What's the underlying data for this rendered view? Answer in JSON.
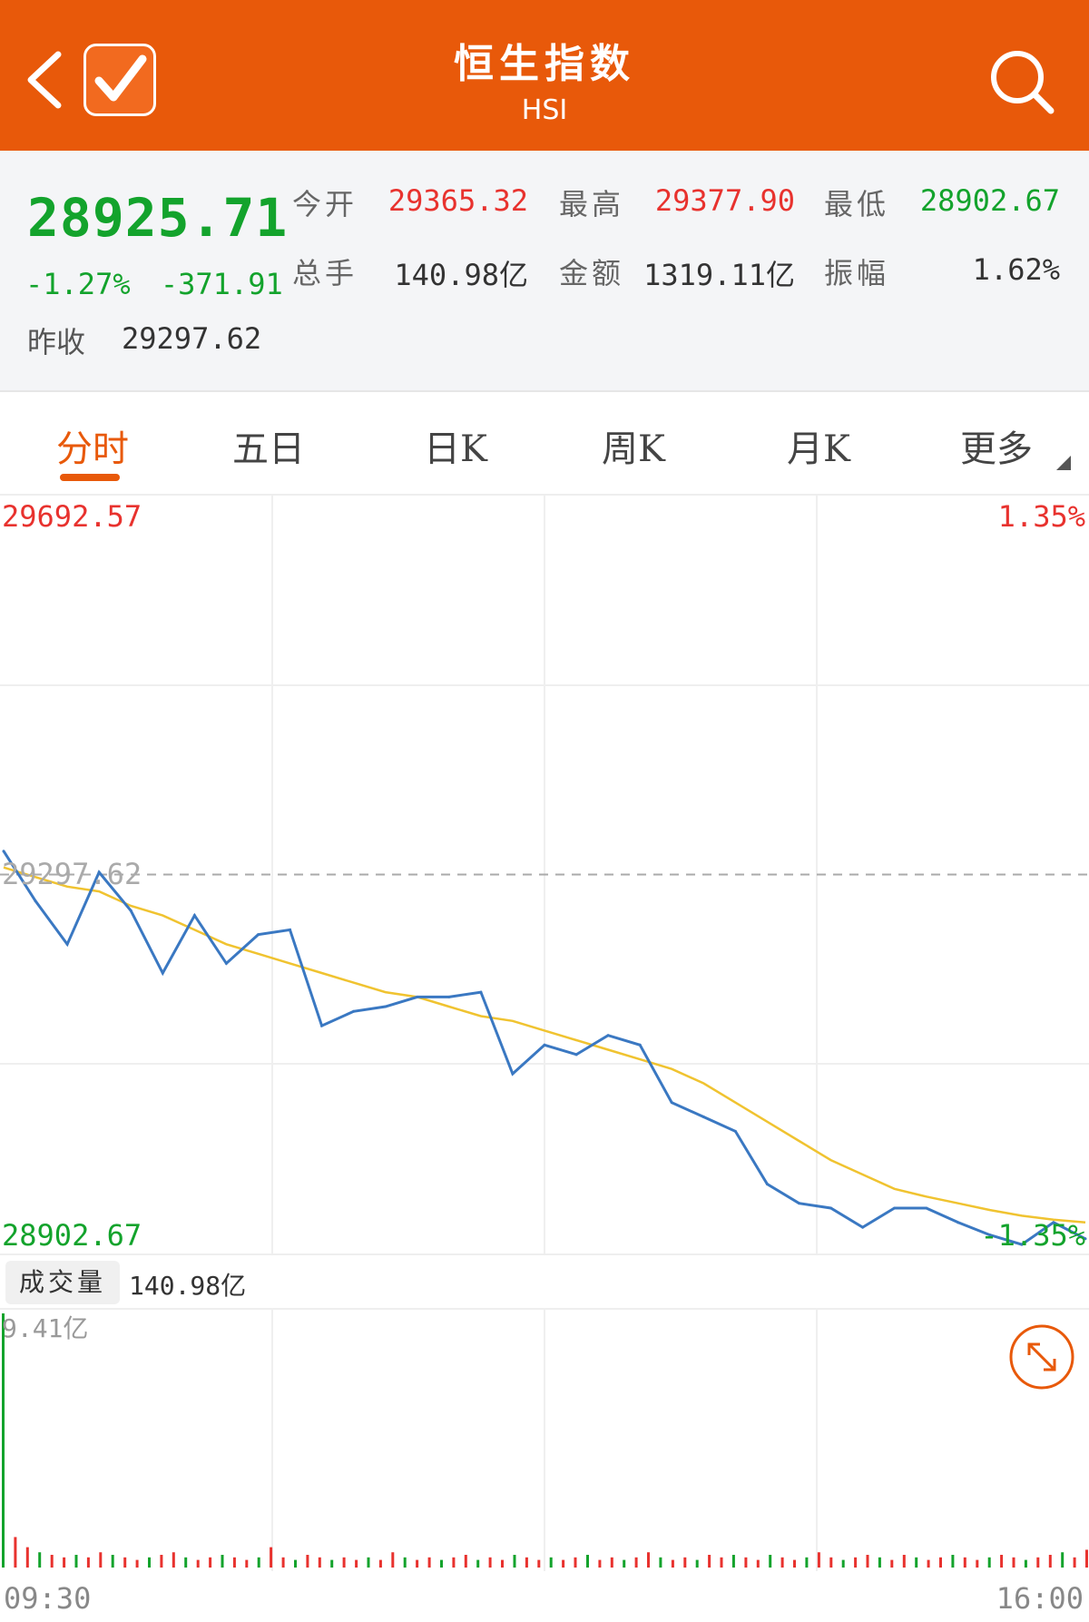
{
  "header": {
    "title": "恒生指数",
    "subtitle": "HSI",
    "back_icon": "chevron-left-icon",
    "watch_icon": "checkbox-checked-icon",
    "search_icon": "search-icon"
  },
  "quote": {
    "price": "28925.71",
    "change_pct": "-1.27%",
    "change_abs": "-371.91",
    "prev_close_label": "昨收",
    "prev_close": "29297.62",
    "stats": [
      {
        "label": "今开",
        "value": "29365.32",
        "color": "#e8322e"
      },
      {
        "label": "最高",
        "value": "29377.90",
        "color": "#e8322e"
      },
      {
        "label": "最低",
        "value": "28902.67",
        "color": "#13a32c"
      },
      {
        "label": "总手",
        "value": "140.98亿",
        "color": "#333333"
      },
      {
        "label": "金额",
        "value": "1319.11亿",
        "color": "#333333"
      },
      {
        "label": "振幅",
        "value": "1.62%",
        "color": "#333333"
      }
    ]
  },
  "tabs": [
    {
      "label": "分时",
      "active": true
    },
    {
      "label": "五日",
      "active": false
    },
    {
      "label": "日K",
      "active": false
    },
    {
      "label": "周K",
      "active": false
    },
    {
      "label": "月K",
      "active": false
    },
    {
      "label": "更多",
      "active": false
    }
  ],
  "chart_labels": {
    "top_left": "29692.57",
    "top_right": "1.35%",
    "mid_left": "29297.62",
    "bottom_left": "28902.67",
    "bottom_right": "-1.35%"
  },
  "volume": {
    "label": "成交量",
    "total": "140.98亿",
    "max_label": "9.41亿",
    "expand_icon": "expand-icon"
  },
  "time_axis": {
    "start": "09:30",
    "end": "16:00"
  },
  "colors": {
    "brand": "#e8590a",
    "up": "#e8322e",
    "down": "#13a32c",
    "price_line": "#3a78c2",
    "avg_line": "#f0c330"
  },
  "chart_data": {
    "type": "line",
    "ylim": [
      28902.67,
      29692.57
    ],
    "baseline": 29297.62,
    "xlim": [
      "09:30",
      "16:00"
    ],
    "series": [
      {
        "name": "",
        "x": [
          "09:30",
          "09:40",
          "09:50",
          "10:00",
          "10:10",
          "10:20",
          "10:30",
          "10:40",
          "10:50",
          "11:00",
          "11:10",
          "11:20",
          "11:30",
          "11:40",
          "11:50",
          "12:00",
          "13:00",
          "13:10",
          "13:20",
          "13:30",
          "13:40",
          "13:50",
          "14:00",
          "14:10",
          "14:20",
          "14:30",
          "14:40",
          "14:50",
          "15:00",
          "15:10",
          "15:20",
          "15:30",
          "15:40",
          "15:50",
          "16:00"
        ],
        "values": [
          29322,
          29270,
          29225,
          29300,
          29260,
          29195,
          29255,
          29205,
          29235,
          29240,
          29140,
          29155,
          29160,
          29170,
          29170,
          29175,
          29090,
          29120,
          29110,
          29130,
          29120,
          29060,
          29045,
          29030,
          28975,
          28955,
          28950,
          28930,
          28950,
          28950,
          28935,
          28922,
          28912,
          28935,
          28918
        ]
      },
      {
        "name": "",
        "values": [
          29305,
          29295,
          29285,
          29280,
          29265,
          29255,
          29240,
          29225,
          29215,
          29205,
          29195,
          29185,
          29175,
          29170,
          29160,
          29150,
          29145,
          29135,
          29125,
          29115,
          29105,
          29095,
          29080,
          29060,
          29040,
          29020,
          29000,
          28985,
          28970,
          28962,
          28955,
          28948,
          28942,
          28938,
          28935
        ]
      }
    ]
  },
  "volume_data": {
    "type": "bar",
    "max_value_label": "9.41亿",
    "values": [
      1.0,
      0.12,
      0.08,
      0.06,
      0.05,
      0.04,
      0.05,
      0.04,
      0.06,
      0.05,
      0.04,
      0.03,
      0.04,
      0.05,
      0.06,
      0.04,
      0.03,
      0.04,
      0.05,
      0.04,
      0.03,
      0.04,
      0.08,
      0.04,
      0.03,
      0.05,
      0.04,
      0.03,
      0.04,
      0.03,
      0.04,
      0.03,
      0.06,
      0.04,
      0.03,
      0.04,
      0.03,
      0.04,
      0.05,
      0.03,
      0.04,
      0.03,
      0.05,
      0.04,
      0.03,
      0.04,
      0.03,
      0.04,
      0.05,
      0.03,
      0.04,
      0.03,
      0.04,
      0.06,
      0.04,
      0.03,
      0.04,
      0.03,
      0.05,
      0.04,
      0.05,
      0.04,
      0.03,
      0.05,
      0.04,
      0.03,
      0.04,
      0.06,
      0.04,
      0.03,
      0.04,
      0.05,
      0.04,
      0.03,
      0.05,
      0.04,
      0.03,
      0.04,
      0.05,
      0.04,
      0.03,
      0.04,
      0.05,
      0.04,
      0.03,
      0.04,
      0.05,
      0.06,
      0.04,
      0.07
    ]
  }
}
